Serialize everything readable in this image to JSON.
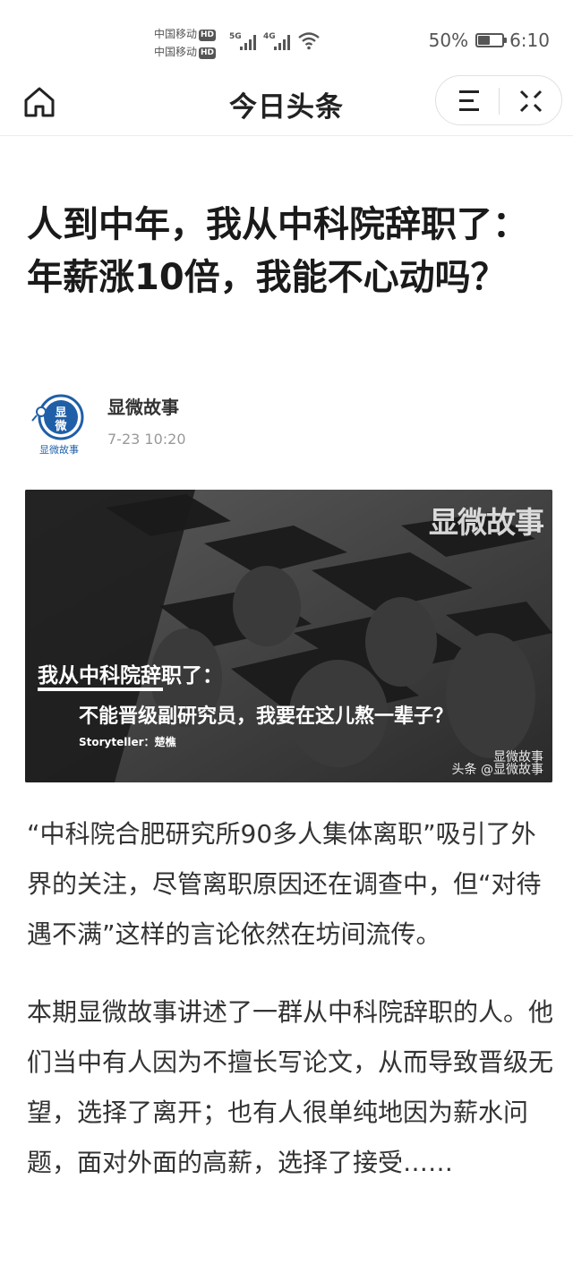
{
  "status_bar": {
    "carrier_1": "中国移动",
    "carrier_2": "中国移动",
    "hd": "HD",
    "net_5g": "5G",
    "net_4g": "4G",
    "battery_text": "50%",
    "battery_level": 0.5,
    "time": "6:10"
  },
  "nav": {
    "title": "今日头条",
    "home_icon": "home-icon",
    "menu_icon": "menu-icon",
    "close_icon": "close-icon"
  },
  "article": {
    "title": "人到中年，我从中科院辞职了：年薪涨10倍，我能不心动吗？",
    "author": {
      "name": "显微故事",
      "time": "7-23 10:20",
      "avatar_top": "显",
      "avatar_mid": "微",
      "avatar_label": "显微故事"
    },
    "cover": {
      "brand": "显微故事",
      "line1": "我从中科院辞职了：",
      "line2": "不能晋级副研究员，我要在这儿熬一辈子？",
      "storyteller": "Storyteller：楚樵",
      "watermark_top": "显微故事",
      "watermark_bottom": "头条 @显微故事"
    },
    "paragraphs": [
      "“中科院合肥研究所90多人集体离职”吸引了外界的关注，尽管离职原因还在调查中，但“对待遇不满”这样的言论依然在坊间流传。",
      "本期显微故事讲述了一群从中科院辞职的人。他们当中有人因为不擅长写论文，从而导致晋级无望，选择了离开；也有人很单纯地因为薪水问题，面对外面的高薪，选择了接受……"
    ]
  },
  "colors": {
    "text": "#222222",
    "muted": "#999999",
    "brand_blue": "#1f5fa8"
  }
}
